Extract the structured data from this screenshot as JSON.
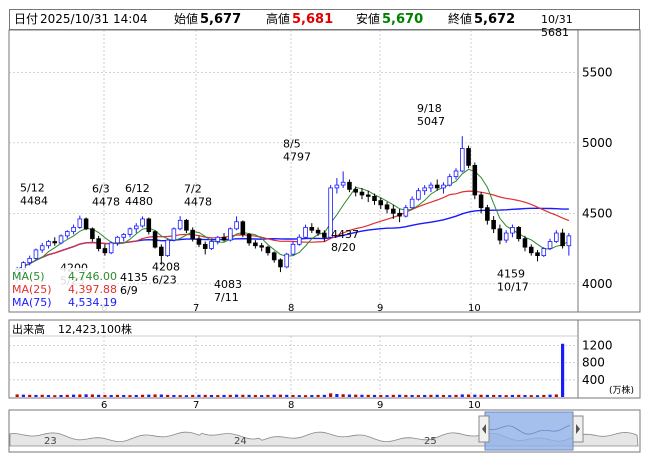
{
  "header": {
    "date_label": "日付",
    "date_value": "2025/10/31 14:04",
    "open_label": "始値",
    "open_value": "5,677",
    "high_label": "高値",
    "high_value": "5,681",
    "low_label": "安値",
    "low_value": "5,670",
    "close_label": "終値",
    "close_value": "5,672"
  },
  "colors": {
    "up": "#1a1aff",
    "down": "#000000",
    "ma5": "#2e8b2e",
    "ma25": "#e03030",
    "ma75": "#1a1aff",
    "volume": "#cc0000",
    "volume_up": "#1a1aff",
    "grid": "#bbbbbb",
    "navigator_fill": "#8fb0e8",
    "high_color": "#e00000",
    "low_color": "#008000"
  },
  "legend": {
    "ma5_label": "MA(5)",
    "ma5_value": "4,746.00",
    "ma25_label": "MA(25)",
    "ma25_value": "4,397.88",
    "ma75_label": "MA(75)",
    "ma75_value": "4,534.19"
  },
  "volume_header": {
    "label": "出来高",
    "value": "12,423,100株"
  },
  "volume_unit": "(万株)",
  "navigator": {
    "month_labels": [
      "23",
      "24",
      "25"
    ]
  },
  "chart_data": [
    {
      "type": "candlestick",
      "x_month_labels": [
        "6",
        "7",
        "8",
        "9",
        "10"
      ],
      "y_ticks": [
        4000,
        4500,
        5000,
        5500
      ],
      "ylim": [
        3800,
        5800
      ],
      "annotations": [
        {
          "date": "5/12",
          "value": 4484
        },
        {
          "date": "5/23",
          "value": 4200
        },
        {
          "date": "6/3",
          "value": 4478
        },
        {
          "date": "6/9",
          "value": 4135
        },
        {
          "date": "6/12",
          "value": 4480
        },
        {
          "date": "6/23",
          "value": 4208
        },
        {
          "date": "7/2",
          "value": 4478
        },
        {
          "date": "7/11",
          "value": 4083
        },
        {
          "date": "8/5",
          "value": 4797
        },
        {
          "date": "8/20",
          "value": 4437
        },
        {
          "date": "9/18",
          "value": 5047
        },
        {
          "date": "10/17",
          "value": 4159
        },
        {
          "date": "10/31",
          "value": 5681
        }
      ],
      "ohlc": [
        [
          4040,
          4120,
          4010,
          4100
        ],
        [
          4100,
          4160,
          4080,
          4150
        ],
        [
          4150,
          4200,
          4130,
          4180
        ],
        [
          4180,
          4250,
          4170,
          4240
        ],
        [
          4240,
          4290,
          4220,
          4270
        ],
        [
          4270,
          4310,
          4250,
          4300
        ],
        [
          4300,
          4330,
          4270,
          4290
        ],
        [
          4290,
          4350,
          4280,
          4340
        ],
        [
          4340,
          4380,
          4320,
          4370
        ],
        [
          4370,
          4420,
          4350,
          4400
        ],
        [
          4400,
          4484,
          4390,
          4460
        ],
        [
          4460,
          4470,
          4380,
          4390
        ],
        [
          4390,
          4400,
          4300,
          4320
        ],
        [
          4320,
          4340,
          4230,
          4250
        ],
        [
          4250,
          4280,
          4200,
          4220
        ],
        [
          4220,
          4300,
          4210,
          4290
        ],
        [
          4290,
          4340,
          4270,
          4330
        ],
        [
          4330,
          4360,
          4300,
          4350
        ],
        [
          4350,
          4400,
          4330,
          4390
        ],
        [
          4390,
          4430,
          4360,
          4410
        ],
        [
          4410,
          4478,
          4400,
          4460
        ],
        [
          4460,
          4470,
          4350,
          4370
        ],
        [
          4370,
          4380,
          4250,
          4260
        ],
        [
          4260,
          4280,
          4135,
          4200
        ],
        [
          4200,
          4320,
          4190,
          4310
        ],
        [
          4310,
          4400,
          4300,
          4390
        ],
        [
          4390,
          4480,
          4380,
          4450
        ],
        [
          4450,
          4460,
          4360,
          4380
        ],
        [
          4380,
          4400,
          4300,
          4320
        ],
        [
          4320,
          4340,
          4260,
          4280
        ],
        [
          4280,
          4300,
          4208,
          4250
        ],
        [
          4250,
          4320,
          4240,
          4300
        ],
        [
          4300,
          4340,
          4280,
          4330
        ],
        [
          4330,
          4360,
          4300,
          4310
        ],
        [
          4310,
          4400,
          4300,
          4390
        ],
        [
          4390,
          4478,
          4380,
          4440
        ],
        [
          4440,
          4450,
          4330,
          4350
        ],
        [
          4350,
          4360,
          4270,
          4290
        ],
        [
          4290,
          4310,
          4250,
          4270
        ],
        [
          4270,
          4290,
          4230,
          4260
        ],
        [
          4260,
          4270,
          4200,
          4220
        ],
        [
          4220,
          4230,
          4150,
          4170
        ],
        [
          4170,
          4180,
          4083,
          4120
        ],
        [
          4120,
          4220,
          4110,
          4210
        ],
        [
          4210,
          4300,
          4200,
          4280
        ],
        [
          4280,
          4350,
          4270,
          4330
        ],
        [
          4330,
          4420,
          4320,
          4400
        ],
        [
          4400,
          4430,
          4360,
          4380
        ],
        [
          4380,
          4400,
          4340,
          4360
        ],
        [
          4360,
          4380,
          4300,
          4330
        ],
        [
          4330,
          4700,
          4320,
          4680
        ],
        [
          4680,
          4750,
          4640,
          4700
        ],
        [
          4700,
          4797,
          4680,
          4720
        ],
        [
          4720,
          4740,
          4650,
          4670
        ],
        [
          4670,
          4690,
          4620,
          4650
        ],
        [
          4650,
          4680,
          4600,
          4630
        ],
        [
          4630,
          4660,
          4580,
          4620
        ],
        [
          4620,
          4640,
          4560,
          4590
        ],
        [
          4590,
          4610,
          4530,
          4560
        ],
        [
          4560,
          4580,
          4500,
          4530
        ],
        [
          4530,
          4560,
          4460,
          4500
        ],
        [
          4500,
          4530,
          4437,
          4480
        ],
        [
          4480,
          4560,
          4470,
          4540
        ],
        [
          4540,
          4620,
          4530,
          4600
        ],
        [
          4600,
          4680,
          4590,
          4660
        ],
        [
          4660,
          4700,
          4630,
          4680
        ],
        [
          4680,
          4720,
          4650,
          4700
        ],
        [
          4700,
          4740,
          4660,
          4680
        ],
        [
          4680,
          4720,
          4640,
          4700
        ],
        [
          4700,
          4780,
          4690,
          4760
        ],
        [
          4760,
          4820,
          4740,
          4800
        ],
        [
          4800,
          5047,
          4790,
          4960
        ],
        [
          4960,
          4980,
          4820,
          4840
        ],
        [
          4840,
          4860,
          4600,
          4630
        ],
        [
          4630,
          4650,
          4500,
          4540
        ],
        [
          4540,
          4560,
          4420,
          4450
        ],
        [
          4450,
          4480,
          4360,
          4390
        ],
        [
          4390,
          4420,
          4280,
          4310
        ],
        [
          4310,
          4380,
          4290,
          4360
        ],
        [
          4360,
          4420,
          4330,
          4400
        ],
        [
          4400,
          4410,
          4300,
          4320
        ],
        [
          4320,
          4340,
          4230,
          4260
        ],
        [
          4260,
          4280,
          4200,
          4220
        ],
        [
          4220,
          4240,
          4159,
          4200
        ],
        [
          4200,
          4260,
          4190,
          4250
        ],
        [
          4250,
          4320,
          4240,
          4300
        ],
        [
          4300,
          4380,
          4290,
          4360
        ],
        [
          4360,
          4390,
          4250,
          4270
        ],
        [
          4270,
          4360,
          4200,
          4340
        ]
      ]
    },
    {
      "type": "bar",
      "title": "出来高",
      "y_ticks": [
        400,
        800,
        1200
      ],
      "ylim": [
        0,
        1400
      ],
      "values": [
        60,
        55,
        50,
        48,
        52,
        45,
        42,
        47,
        50,
        55,
        58,
        62,
        60,
        52,
        48,
        45,
        50,
        46,
        44,
        48,
        52,
        55,
        60,
        58,
        50,
        46,
        44,
        42,
        48,
        52,
        50,
        47,
        45,
        48,
        50,
        55,
        52,
        50,
        46,
        44,
        48,
        52,
        55,
        50,
        46,
        44,
        42,
        45,
        48,
        50,
        85,
        70,
        65,
        58,
        55,
        52,
        50,
        48,
        46,
        44,
        50,
        52,
        48,
        46,
        44,
        48,
        50,
        52,
        46,
        44,
        50,
        60,
        58,
        55,
        52,
        50,
        48,
        46,
        44,
        48,
        50,
        46,
        44,
        42,
        48,
        55,
        60,
        1242
      ]
    }
  ]
}
